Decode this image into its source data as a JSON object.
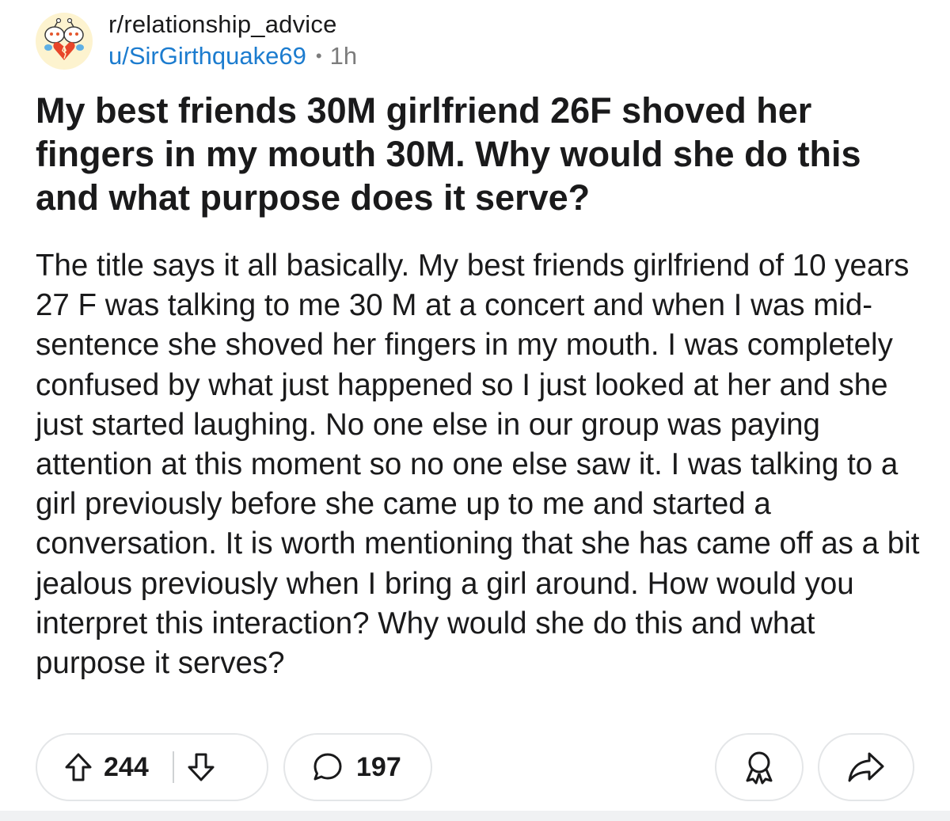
{
  "post": {
    "subreddit": "r/relationship_advice",
    "author": "u/SirGirthquake69",
    "separator": "•",
    "time": "1h",
    "title": "My best friends 30M girlfriend 26F shoved her fingers in my mouth 30M. Why would she do this and what purpose does it serve?",
    "body": "The title says it all basically. My best friends girlfriend of 10 years 27 F was talking to me 30 M at a concert and when I was mid-sentence she shoved her fingers in my mouth. I was completely confused by what just happened so I just looked at her and she just started laughing. No one else in our group was paying attention at this moment so no one else saw it. I was talking to a girl previously before she came up to me and started a conversation. It is worth mentioning that she has came off as a bit jealous previously when I bring a girl around. How would you interpret this interaction? Why would she do this and what purpose it serves?"
  },
  "actions": {
    "upvote_icon": "arrow-up-icon",
    "vote_count": "244",
    "downvote_icon": "arrow-down-icon",
    "comment_icon": "speech-bubble-icon",
    "comment_count": "197",
    "award_icon": "award-ribbon-icon",
    "share_icon": "share-arrow-icon"
  },
  "colors": {
    "author_link": "#1c7ccf",
    "text": "#1a1a1b",
    "muted": "#7c7c7c",
    "pill_border": "#e4e6e8",
    "avatar_bg": "#fdf3cf"
  }
}
